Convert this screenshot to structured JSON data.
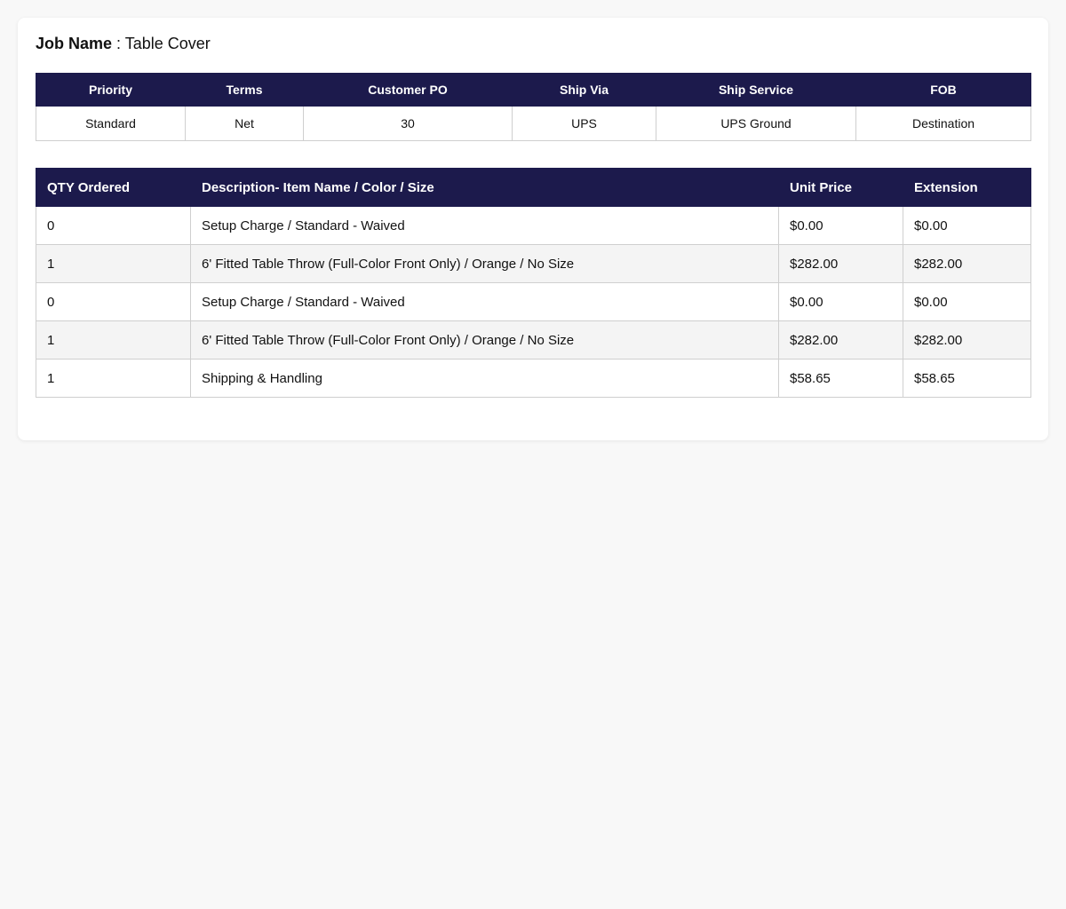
{
  "job": {
    "label": "Job Name",
    "separator": " : ",
    "value": "Table Cover"
  },
  "summary": {
    "headers": [
      "Priority",
      "Terms",
      "Customer PO",
      "Ship Via",
      "Ship Service",
      "FOB"
    ],
    "values": [
      "Standard",
      "Net",
      "30",
      "UPS",
      "UPS Ground",
      "Destination"
    ]
  },
  "items": {
    "headers": [
      "QTY Ordered",
      "Description- Item Name / Color / Size",
      "Unit Price",
      "Extension"
    ],
    "rows": [
      {
        "qty": "0",
        "description": "Setup Charge / Standard - Waived",
        "unit_price": "$0.00",
        "extension": "$0.00"
      },
      {
        "qty": "1",
        "description": "6' Fitted Table Throw (Full-Color Front Only) / Orange / No Size",
        "unit_price": "$282.00",
        "extension": "$282.00"
      },
      {
        "qty": "0",
        "description": "Setup Charge / Standard - Waived",
        "unit_price": "$0.00",
        "extension": "$0.00"
      },
      {
        "qty": "1",
        "description": "6' Fitted Table Throw (Full-Color Front Only) / Orange / No Size",
        "unit_price": "$282.00",
        "extension": "$282.00"
      },
      {
        "qty": "1",
        "description": "Shipping & Handling",
        "unit_price": "$58.65",
        "extension": "$58.65"
      }
    ]
  },
  "colors": {
    "header_bg": "#1c1a4c",
    "header_text": "#ffffff",
    "row_alt": "#f4f4f4",
    "page_bg": "#f8f8f8"
  }
}
